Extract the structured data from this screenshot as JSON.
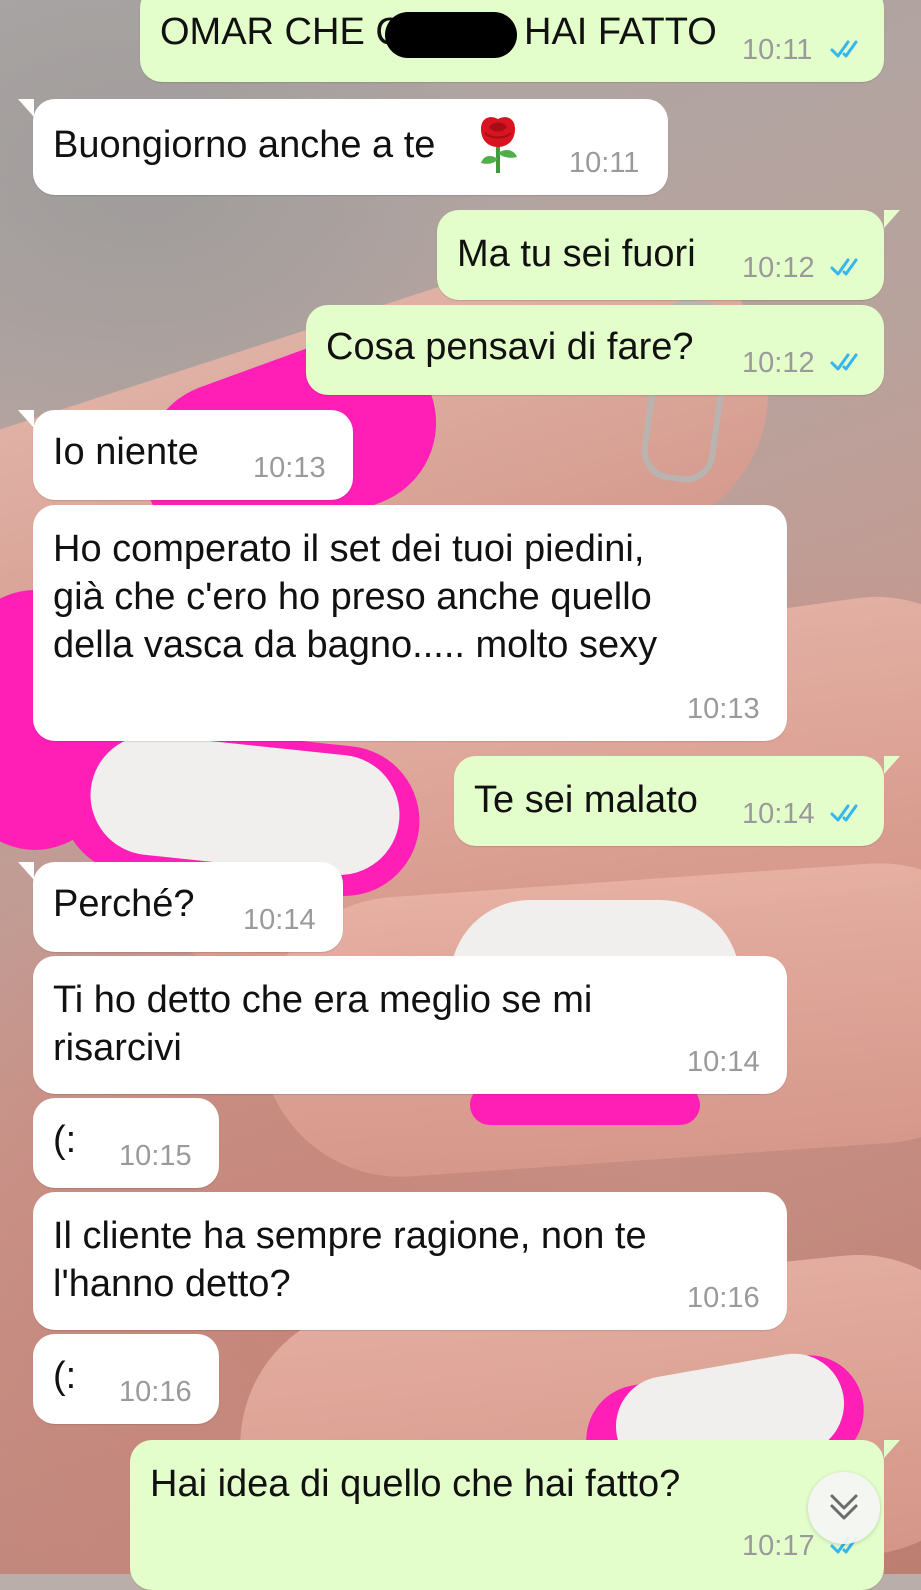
{
  "chat": {
    "messages": [
      {
        "direction": "out",
        "text_before": "OMAR CHE C",
        "text_after": "HAI FATTO",
        "time": "10:11",
        "status": "read"
      },
      {
        "direction": "in",
        "text": "Buongiorno anche a te",
        "emoji": "rose",
        "time": "10:11"
      },
      {
        "direction": "out",
        "text": "Ma tu sei fuori",
        "time": "10:12",
        "status": "read"
      },
      {
        "direction": "out",
        "text": "Cosa pensavi di fare?",
        "time": "10:12",
        "status": "read"
      },
      {
        "direction": "in",
        "text": "Io niente",
        "time": "10:13"
      },
      {
        "direction": "in",
        "text": "Ho comperato il set dei tuoi piedini,\ngià che c'ero ho preso anche quello\ndella vasca da bagno..... molto sexy",
        "time": "10:13"
      },
      {
        "direction": "out",
        "text": "Te sei malato",
        "time": "10:14",
        "status": "read"
      },
      {
        "direction": "in",
        "text": "Perché?",
        "time": "10:14"
      },
      {
        "direction": "in",
        "text": "Ti ho detto che era meglio se mi\nrisarcivi",
        "time": "10:14"
      },
      {
        "direction": "in",
        "text": "(:",
        "time": "10:15"
      },
      {
        "direction": "in",
        "text": "Il cliente ha sempre ragione, non te\nl'hanno detto?",
        "time": "10:16"
      },
      {
        "direction": "in",
        "text": "(:",
        "time": "10:16"
      },
      {
        "direction": "out",
        "text": "Hai idea di quello che hai fatto?",
        "time": "10:17",
        "status": "read"
      }
    ]
  },
  "colors": {
    "incoming_bubble": "#ffffff",
    "outgoing_bubble": "#e3fdcb",
    "read_ticks": "#34b7f1",
    "timestamp": "#9a9a9a"
  },
  "icons": {
    "read_receipt": "double-check-icon",
    "emoji": "rose-emoji-icon",
    "scroll_down": "chevron-down-double-icon"
  }
}
